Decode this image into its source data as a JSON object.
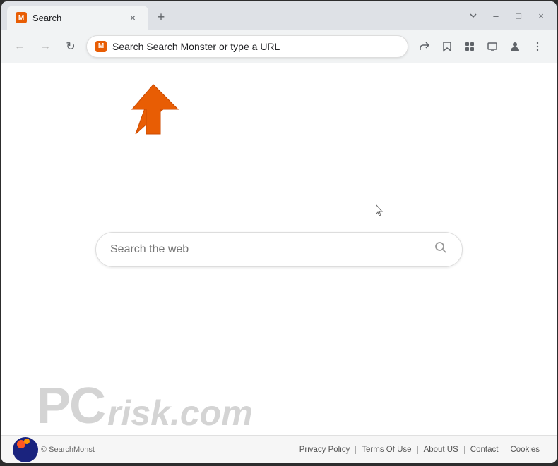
{
  "browser": {
    "tab": {
      "favicon": "M",
      "title": "Search",
      "close_label": "×"
    },
    "new_tab_label": "+",
    "window_controls": {
      "minimize": "–",
      "maximize": "□",
      "close": "×"
    },
    "address_bar": {
      "favicon": "M",
      "url": "Search Search Monster or type a URL"
    },
    "toolbar": {
      "back_icon": "←",
      "forward_icon": "→",
      "reload_icon": "↻",
      "share_icon": "⬆",
      "bookmark_icon": "☆",
      "extensions_icon": "⊞",
      "cast_icon": "▭",
      "profile_icon": "👤",
      "menu_icon": "⋮"
    }
  },
  "page": {
    "search_placeholder": "Search the web",
    "footer": {
      "copyright": "© SearchMonst",
      "links": [
        "Privacy Policy",
        "Terms Of Use",
        "About US",
        "Contact",
        "Cookies"
      ]
    }
  },
  "overlay": {
    "pcRisk": "PC",
    "risk": "risk.com"
  }
}
